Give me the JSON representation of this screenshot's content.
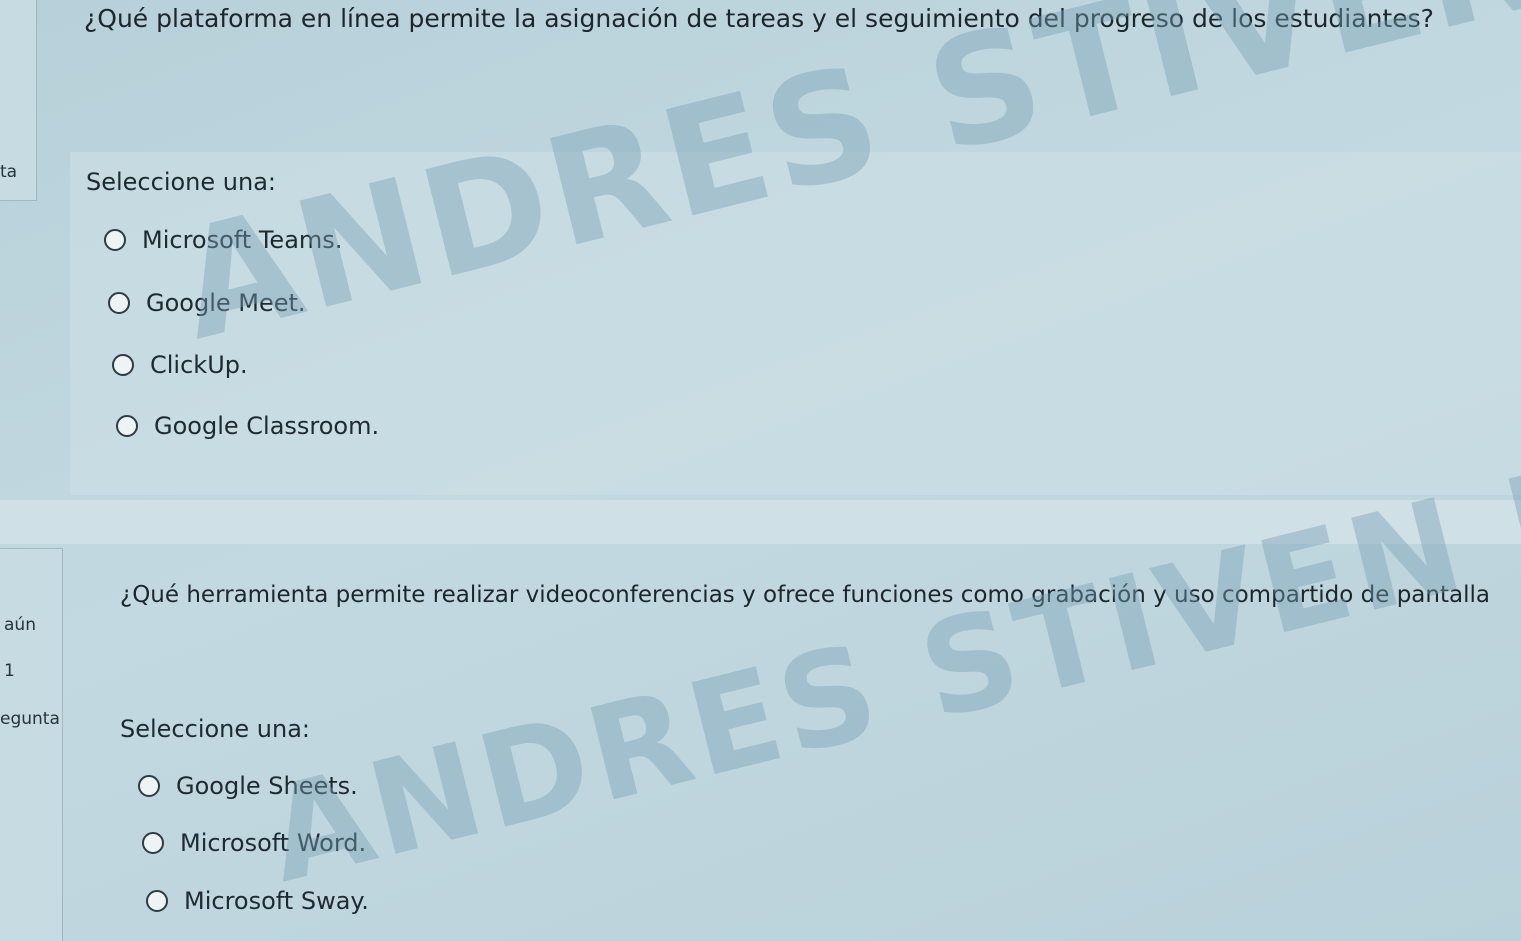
{
  "sidebar": {
    "q1_state": "ta",
    "q2_state": "aún",
    "q2_score": "1",
    "q2_label": "egunta"
  },
  "question1": {
    "text": "¿Qué plataforma en línea permite la asignación de tareas y el seguimiento del progreso de los estudiantes?",
    "prompt": "Seleccione una:",
    "options": [
      "Microsoft Teams.",
      "Google Meet.",
      "ClickUp.",
      "Google Classroom."
    ]
  },
  "question2": {
    "text": "¿Qué herramienta permite realizar videoconferencias y ofrece funciones como grabación y uso compartido de pantalla",
    "prompt": "Seleccione una:",
    "options": [
      "Google Sheets.",
      "Microsoft Word.",
      "Microsoft Sway."
    ]
  },
  "watermark": {
    "text": "ANDRES STIVEN BARON"
  }
}
